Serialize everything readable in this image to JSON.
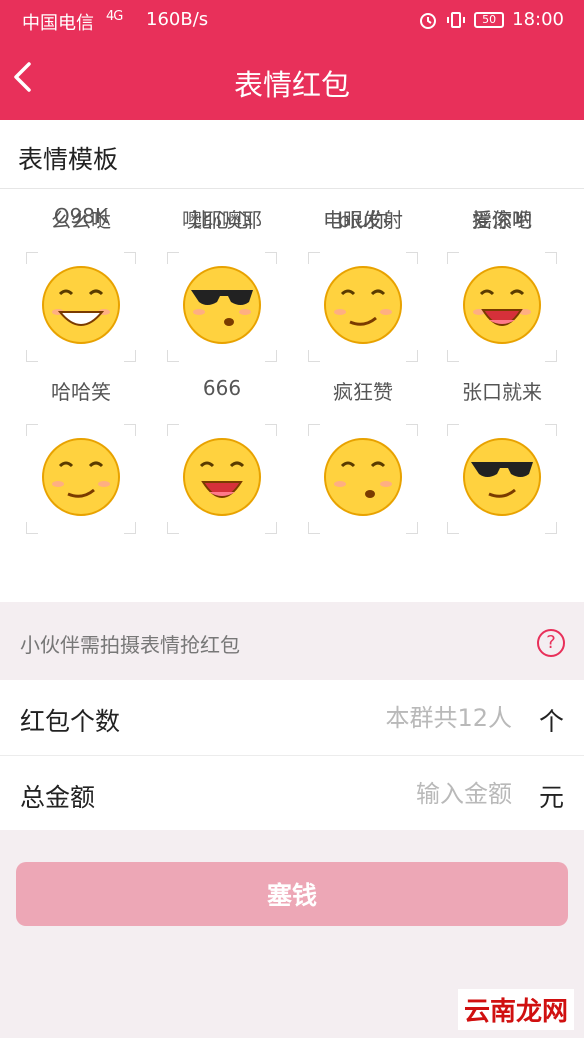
{
  "status_bar": {
    "carrier": "中国电信",
    "signal": "4G",
    "speed": "160B/s",
    "battery": "50",
    "time": "18:00"
  },
  "header": {
    "title": "表情红包"
  },
  "template_section": {
    "title": "表情模板",
    "items": [
      {
        "label": "么么哒",
        "icon": "kiss-emoji-icon"
      },
      {
        "label": "比心心",
        "icon": "heart-hands-emoji-icon"
      },
      {
        "label": "电眼发射",
        "icon": "wink-emoji-icon"
      },
      {
        "label": "爱你哟",
        "icon": "love-you-emoji-icon"
      },
      {
        "label": "哈哈笑",
        "icon": "laugh-emoji-icon"
      },
      {
        "label": "666",
        "icon": "sunglasses-666-emoji-icon"
      },
      {
        "label": "疯狂赞",
        "icon": "thumbs-up-emoji-icon"
      },
      {
        "label": "张口就来",
        "icon": "open-mouth-emoji-icon"
      },
      {
        "label": "O98K",
        "icon": "ok-hand-emoji-icon"
      },
      {
        "label": "噢耶噢耶",
        "icon": "victory-emoji-icon"
      },
      {
        "label": "biu你",
        "icon": "finger-gun-emoji-icon"
      },
      {
        "label": "摇滚吧",
        "icon": "rock-sunglasses-emoji-icon"
      }
    ]
  },
  "hint": {
    "text": "小伙伴需拍摄表情抢红包",
    "help_icon": "?"
  },
  "form": {
    "count_label": "红包个数",
    "count_placeholder": "本群共12人",
    "count_unit": "个",
    "amount_label": "总金额",
    "amount_placeholder": "输入金额",
    "amount_unit": "元"
  },
  "submit_label": "塞钱",
  "watermark": "云南龙网",
  "colors": {
    "brand": "#e8305a",
    "button_disabled": "#eda7b6"
  }
}
